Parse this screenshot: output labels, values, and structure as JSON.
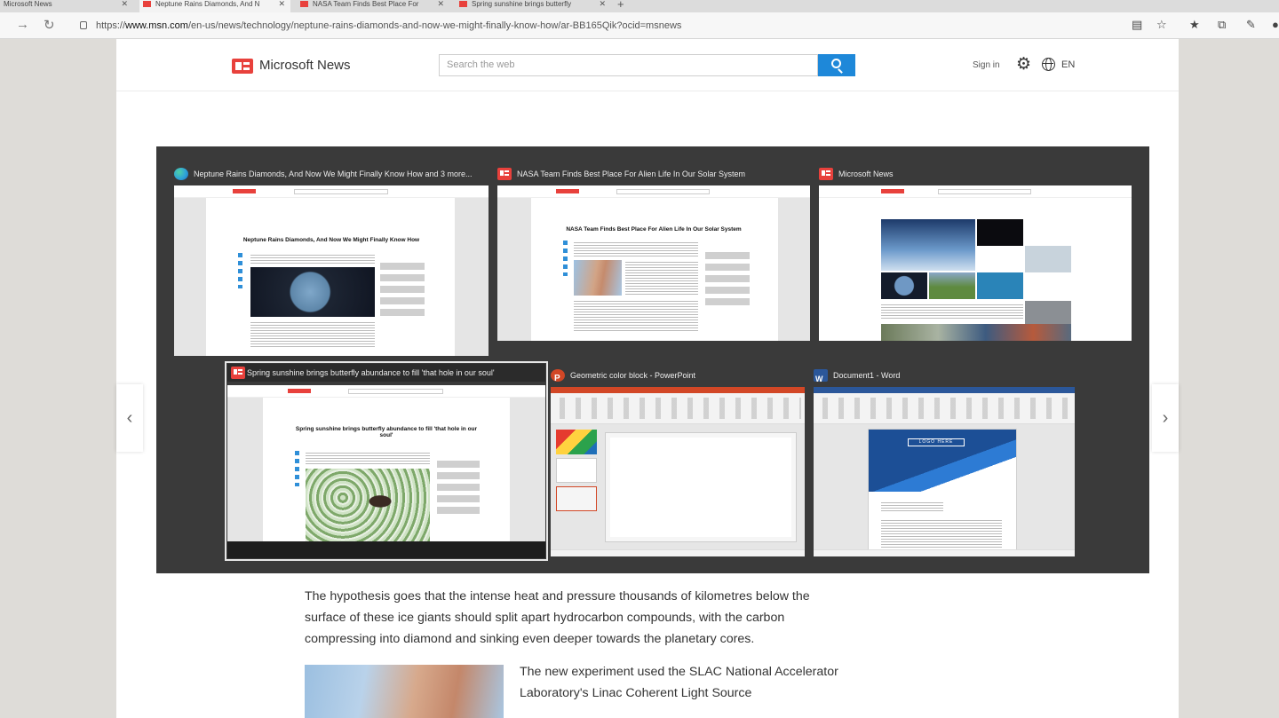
{
  "browser": {
    "tabs": [
      {
        "label": "Microsoft News",
        "active": false
      },
      {
        "label": "Neptune Rains Diamonds, And N",
        "active": true
      },
      {
        "label": "NASA Team Finds Best Place For",
        "active": false
      },
      {
        "label": "Spring sunshine brings butterfly",
        "active": false
      }
    ],
    "url_prefix": "https://",
    "url_host": "www.msn.com",
    "url_path": "/en-us/news/technology/neptune-rains-diamonds-and-now-we-might-finally-know-how/ar-BB165Qik?ocid=msnews"
  },
  "msn": {
    "brand": "Microsoft News",
    "search_placeholder": "Search the web",
    "signin": "Sign in",
    "language": "EN"
  },
  "switcher": {
    "windows": [
      {
        "title": "Neptune Rains Diamonds, And Now We Might Finally Know How and 3 more...",
        "preview_title": "Neptune Rains Diamonds, And Now We Might Finally Know How"
      },
      {
        "title": "NASA Team Finds Best Place For Alien Life In Our Solar System",
        "preview_title": "NASA Team Finds Best Place For Alien Life In Our Solar System"
      },
      {
        "title": "Microsoft News"
      },
      {
        "title": "Spring sunshine brings butterfly abundance to fill 'that hole in our soul'",
        "preview_title": "Spring sunshine brings butterfly abundance to fill 'that hole in our soul'"
      },
      {
        "title": "Geometric color block - PowerPoint"
      },
      {
        "title": "Document1 - Word",
        "doc_logo": "LOGO HERE"
      }
    ]
  },
  "article": {
    "paragraph1": "The hypothesis goes that the intense heat and pressure thousands of kilometres below the surface of these ice giants should split apart hydrocarbon compounds, with the carbon compressing into diamond and sinking even deeper towards the planetary cores.",
    "paragraph2": "The new experiment used the SLAC National Accelerator Laboratory's Linac Coherent Light Source"
  },
  "colors": {
    "accent": "#1e88d9",
    "news_red": "#e8413c",
    "switcher_bg": "#3a3a3a",
    "ppt": "#d24726",
    "word": "#2b579a"
  }
}
